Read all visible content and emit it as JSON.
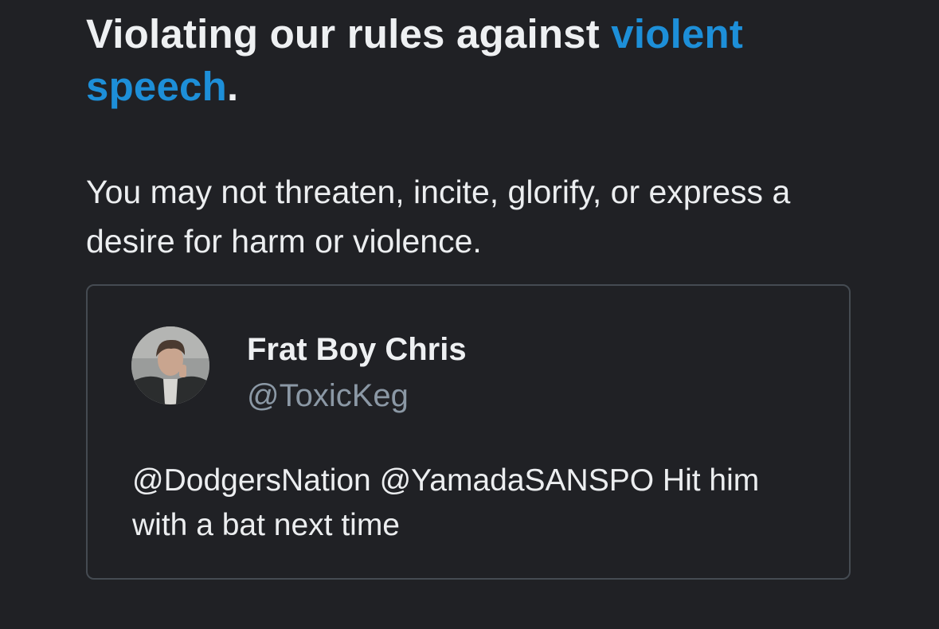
{
  "rule": {
    "heading_prefix": "Violating our rules against ",
    "heading_link": "violent speech",
    "heading_suffix": ".",
    "description": "You may not threaten, incite, glorify, or express a desire for harm or violence."
  },
  "tweet": {
    "display_name": "Frat Boy Chris",
    "handle": "@ToxicKeg",
    "text": "@DodgersNation @YamadaSANSPO Hit him with a bat next time"
  },
  "colors": {
    "background": "#202125",
    "link": "#1d8fd8",
    "handle": "#8b98a5",
    "card_border": "#454b52"
  }
}
